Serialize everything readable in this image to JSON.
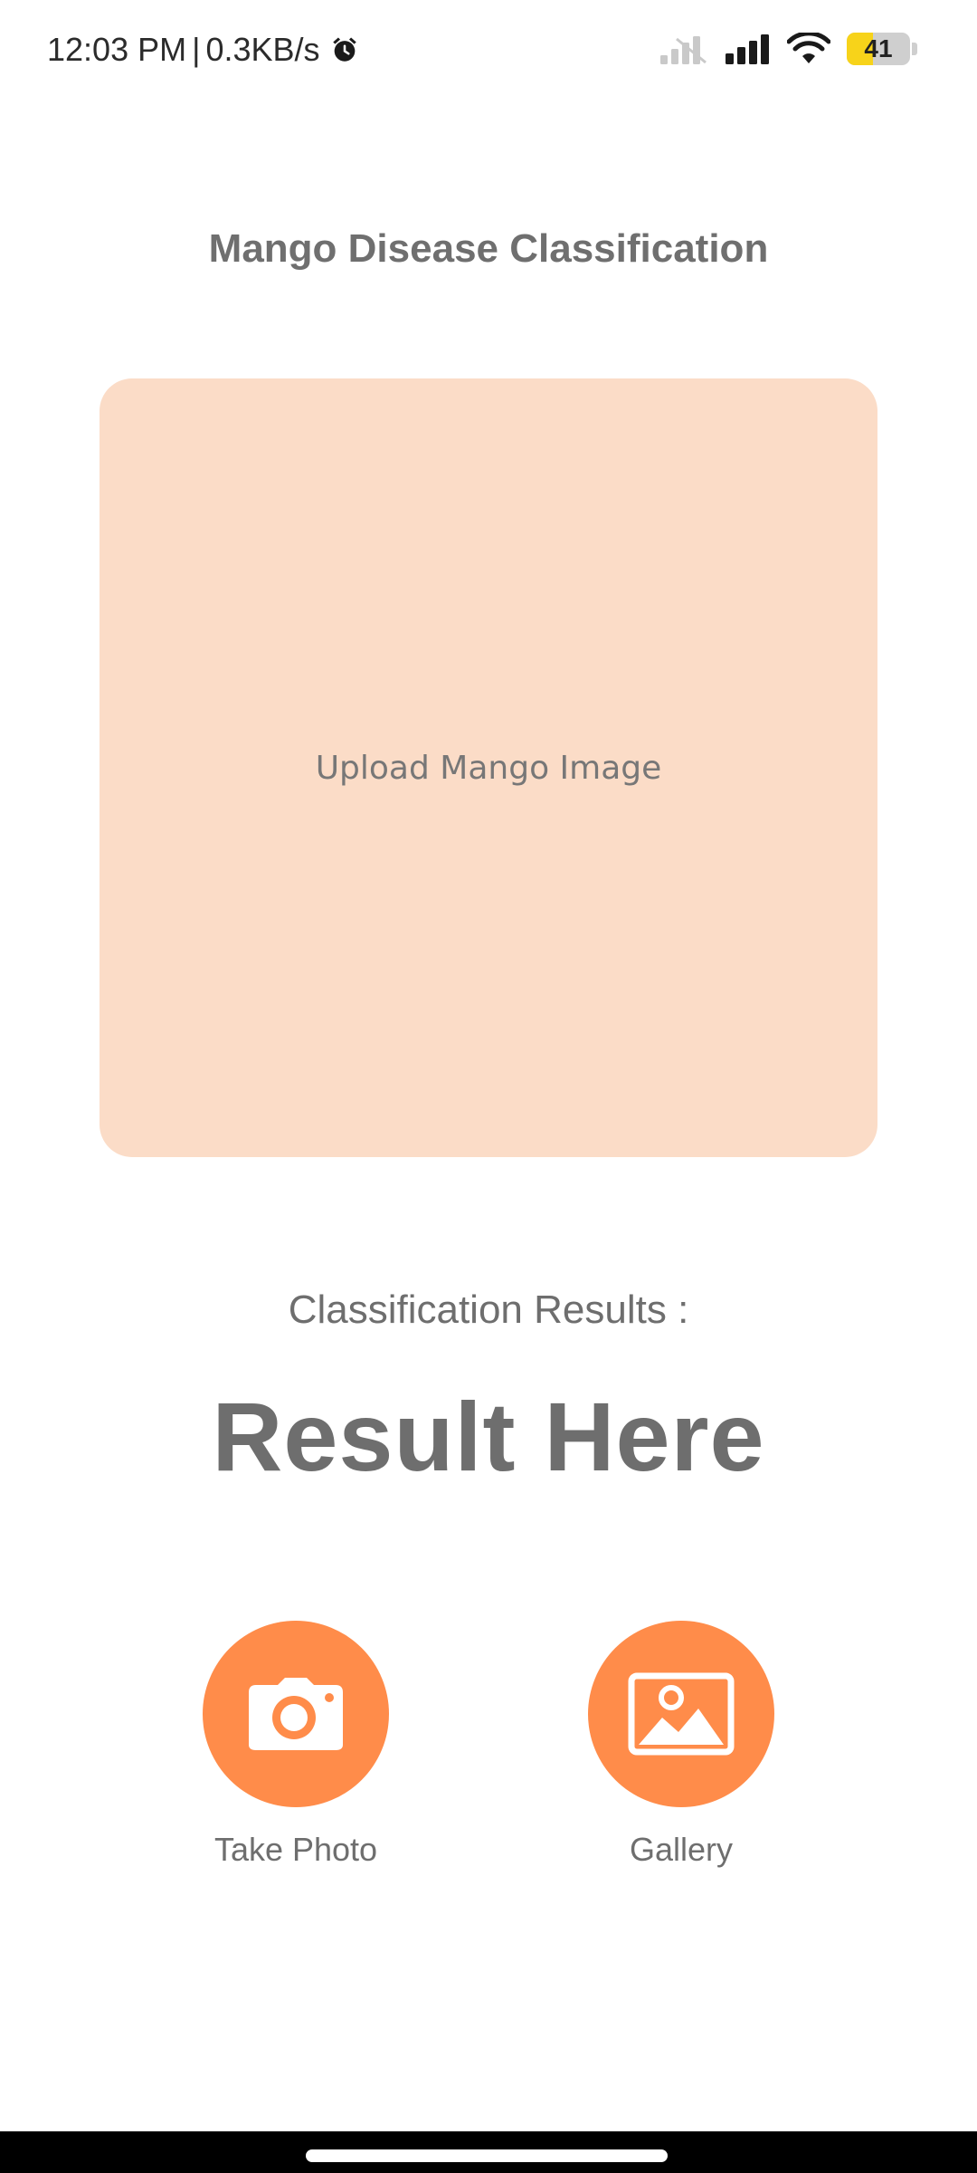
{
  "status_bar": {
    "time": "12:03 PM",
    "separator": "|",
    "network_speed": "0.3KB/s",
    "battery_level": "41",
    "battery_fraction": 0.41,
    "icons": [
      "alarm-icon",
      "signal-off-icon",
      "signal-icon",
      "wifi-icon",
      "battery-icon"
    ]
  },
  "header": {
    "title": "Mango Disease Classification"
  },
  "upload": {
    "label": "Upload Mango Image"
  },
  "results": {
    "label": "Classification Results :",
    "value": "Result Here"
  },
  "actions": {
    "take_photo": {
      "label": "Take Photo",
      "icon": "camera-icon"
    },
    "gallery": {
      "label": "Gallery",
      "icon": "image-icon"
    }
  },
  "colors": {
    "accent": "#ff8c4a",
    "upload_bg": "#fbdcc7",
    "text": "#6e6e6e"
  }
}
